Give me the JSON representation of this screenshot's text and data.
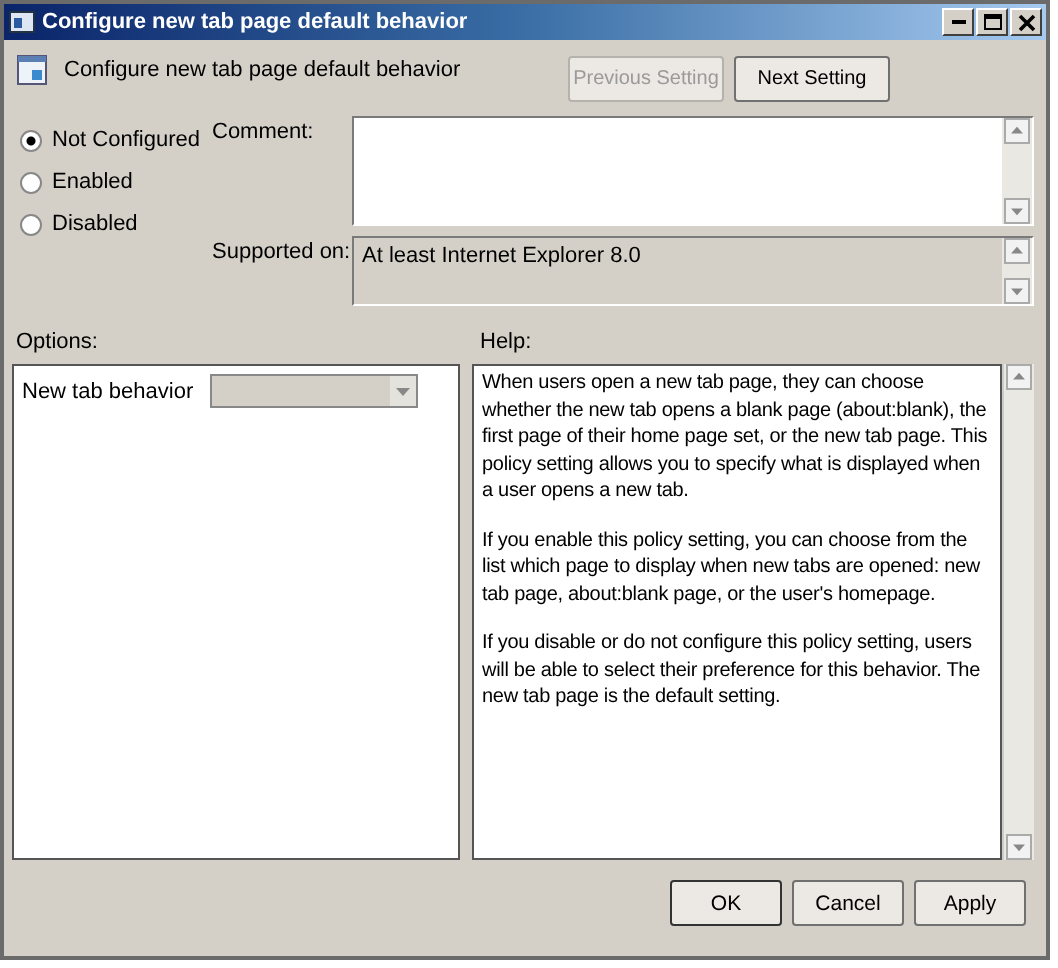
{
  "window": {
    "title": "Configure new tab page default behavior"
  },
  "header": {
    "title": "Configure new tab page default behavior",
    "buttons": [
      {
        "label": "Previous Setting",
        "disabled": true
      },
      {
        "label": "Next Setting",
        "disabled": false
      }
    ]
  },
  "state_options": [
    {
      "label": "Not Configured",
      "selected": true
    },
    {
      "label": "Enabled",
      "selected": false
    },
    {
      "label": "Disabled",
      "selected": false
    }
  ],
  "comment": {
    "label": "Comment:"
  },
  "supported_on": {
    "label": "Supported on:",
    "value": "At least Internet Explorer 8.0"
  },
  "options": {
    "label": "Options:",
    "items": [
      {
        "label": "New tab behavior",
        "disabled": true
      }
    ]
  },
  "help": {
    "label": "Help:",
    "paragraphs": [
      "When users open a new tab page, they can choose whether the new tab opens a blank page (about:blank), the first page of their home page set, or the new tab page. This policy setting allows you to specify what is displayed when a user opens a new tab.",
      "If you enable this policy setting, you can choose from the list which page to display when new tabs are opened: new tab page, about:blank page, or the user's homepage.",
      "If you disable or do not configure this policy setting, users will be able to select their preference for this behavior. The new tab page is the default setting."
    ]
  },
  "buttons": [
    "OK",
    "Cancel",
    "Apply"
  ]
}
